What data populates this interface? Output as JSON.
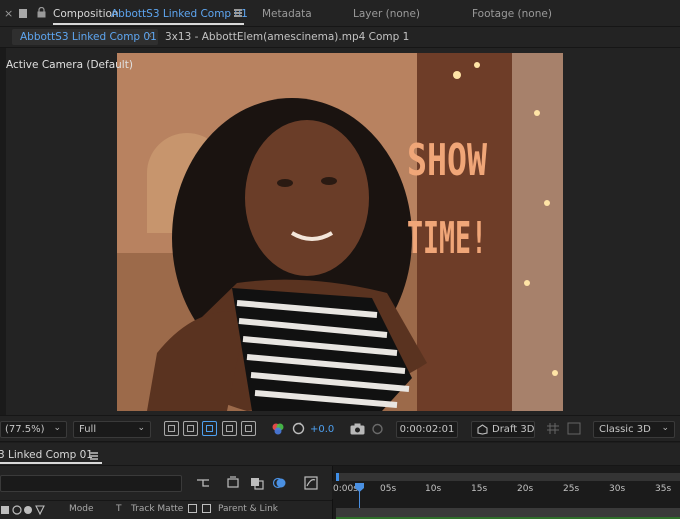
{
  "composition_panel": {
    "close_glyph": "×",
    "tab_prefix": "Composition",
    "comp_name": "AbbottS3 Linked Comp 01",
    "other_tabs": [
      "Metadata",
      "Layer (none)",
      "Footage (none)"
    ]
  },
  "breadcrumbs": {
    "current": "AbbottS3 Linked Comp 01",
    "separator": "‹",
    "next": "3x13 - AbbottElem(amescinema).mp4 Comp 1"
  },
  "viewer": {
    "camera_label": "Active Camera (Default)",
    "frame_text_line1": "SHOW",
    "frame_text_line2": "TIME!"
  },
  "viewer_controls": {
    "zoom": "(77.5%)",
    "resolution": "Full",
    "exposure": "+0.0",
    "timecode": "0:00:02:01",
    "draft_label": "Draft 3D",
    "renderer": "Classic 3D",
    "chevron": "⌄"
  },
  "timeline": {
    "tab_name": "3 Linked Comp 01",
    "columns": [
      "Mode",
      "T",
      "Track Matte",
      "Parent & Link"
    ],
    "ruler_ticks": [
      "0:00s",
      "05s",
      "10s",
      "15s",
      "20s",
      "25s",
      "30s",
      "35s"
    ]
  },
  "icons": {
    "lock": "lock-icon",
    "menu": "hamburger-icon",
    "snapshot": "camera-icon",
    "color": "rgb-channels-icon"
  },
  "colors": {
    "accent_blue": "#5ea6f1",
    "panel_bg": "#232323",
    "show_time_text": "#f0a678"
  }
}
